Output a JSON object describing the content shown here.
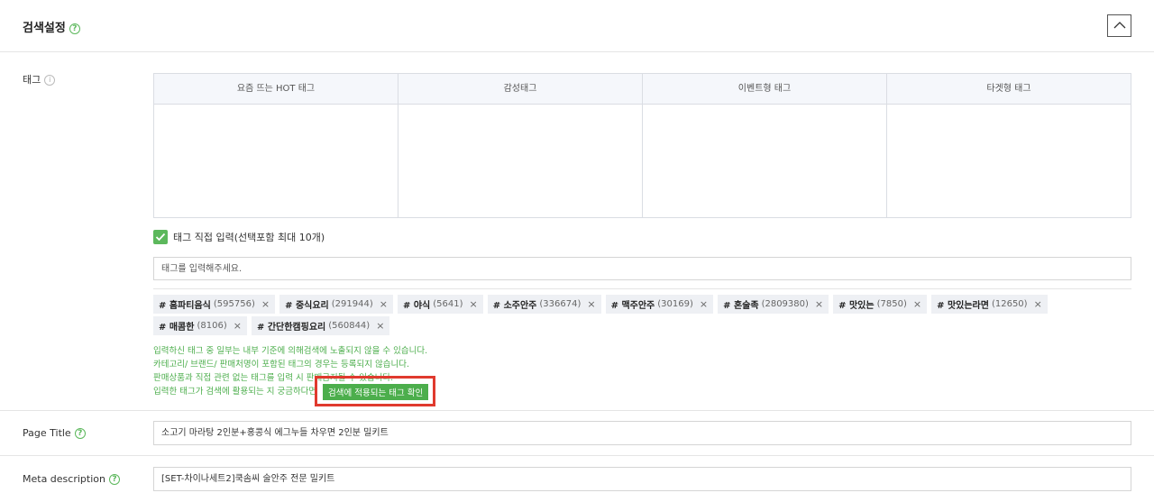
{
  "header": {
    "title": "검색설정",
    "help_icon": "?"
  },
  "tags": {
    "label": "태그",
    "info_icon": "i",
    "columns": [
      "요즘 뜨는 HOT 태그",
      "감성태그",
      "이벤트형 태그",
      "타겟형 태그"
    ],
    "direct_input_label": "태그 직접 입력(선택포함 최대 10개)",
    "direct_input_checked": true,
    "input_placeholder": "태그를 입력해주세요.",
    "chips": [
      {
        "name": "# 홈파티음식",
        "count": "(595756)"
      },
      {
        "name": "# 중식요리",
        "count": "(291944)"
      },
      {
        "name": "# 야식",
        "count": "(5641)"
      },
      {
        "name": "# 소주안주",
        "count": "(336674)"
      },
      {
        "name": "# 맥주안주",
        "count": "(30169)"
      },
      {
        "name": "# 혼술족",
        "count": "(2809380)"
      },
      {
        "name": "# 맛있는",
        "count": "(7850)"
      },
      {
        "name": "# 맛있는라면",
        "count": "(12650)"
      },
      {
        "name": "# 매콤한",
        "count": "(8106)"
      },
      {
        "name": "# 간단한캠핑요리",
        "count": "(560844)"
      }
    ],
    "notices": [
      "입력하신 태그 중 일부는 내부 기준에 의해검색에 노출되지 않을 수 있습니다.",
      "카테고리/ 브랜드/ 판매처명이 포함된 태그의 경우는 등록되지 않습니다.",
      "판매상품과 직접 관련 없는 태그를 입력 시 판매금지될 수 있습니다.",
      "입력한 태그가 검색에 활용되는 지 궁금하다면"
    ],
    "check_button": "검색에 적용되는 태그 확인"
  },
  "page_title": {
    "label": "Page Title",
    "value": "소고기 마라탕 2인분+홍콩식 에그누들 차우면 2인분 밀키트"
  },
  "meta_description": {
    "label": "Meta description",
    "value": "[SET-차이나세트2]쿡솜씨 술안주 전문 밀키트"
  },
  "colors": {
    "accent": "#5cb85c",
    "highlight": "#e03a2e"
  }
}
